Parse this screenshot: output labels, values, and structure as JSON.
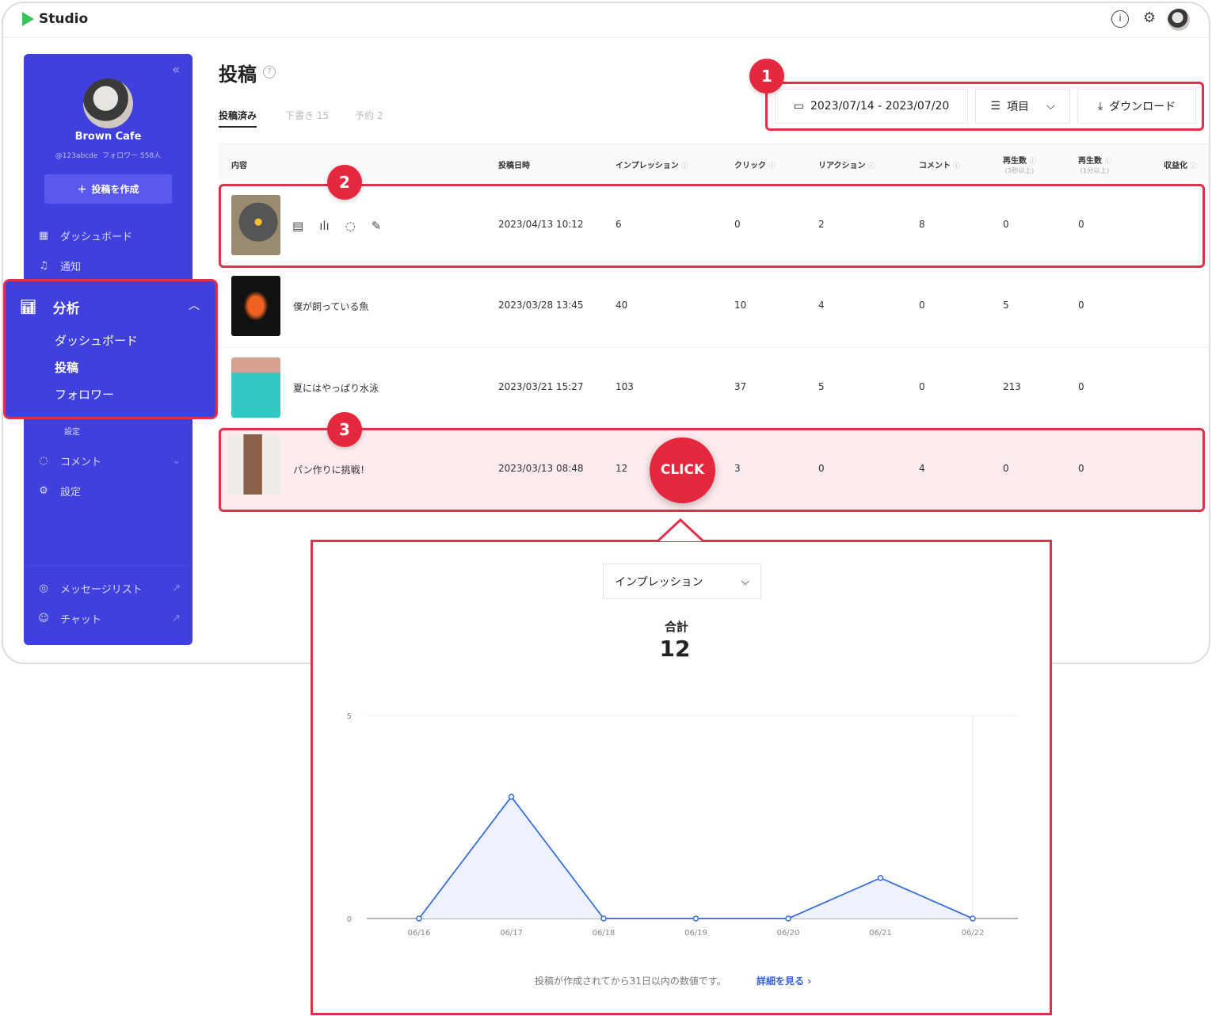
{
  "app": {
    "name": "Studio",
    "icons": [
      "info-icon",
      "gear-icon",
      "avatar"
    ]
  },
  "sidebar": {
    "profile_name": "Brown Cafe",
    "profile_handle": "@123abcde",
    "profile_followers": "フォロワー 558人",
    "create_label": "投稿を作成",
    "collapse_icon": "«",
    "items": [
      {
        "label": "ダッシュボード",
        "icon": "grid-icon"
      },
      {
        "label": "通知",
        "icon": "bell-icon"
      }
    ],
    "analytics": {
      "label": "分析",
      "sub": [
        "ダッシュボード",
        "投稿",
        "フォロワー"
      ],
      "hidden_sub": "設定"
    },
    "items2": [
      {
        "label": "コメント",
        "icon": "comment-icon"
      },
      {
        "label": "設定",
        "icon": "gear-icon"
      }
    ],
    "bottom": [
      {
        "label": "メッセージリスト",
        "icon": "broadcast-icon"
      },
      {
        "label": "チャット",
        "icon": "chat-icon"
      }
    ]
  },
  "page": {
    "title": "投稿",
    "tabs": [
      {
        "label": "投稿済み"
      },
      {
        "label": "下書き 15"
      },
      {
        "label": "予約 2"
      }
    ]
  },
  "toolbar": {
    "date_range": "2023/07/14 - 2023/07/20",
    "columns_label": "項目",
    "download_label": "ダウンロード"
  },
  "badges": [
    "1",
    "2",
    "3"
  ],
  "click_label": "CLICK",
  "table": {
    "headers": [
      "内容",
      "投稿日時",
      "インプレッション",
      "クリック",
      "リアクション",
      "コメント",
      "再生数",
      "再生数",
      "収益化"
    ],
    "subheaders": [
      "(3秒以上)",
      "(1分以上)"
    ],
    "rows": [
      {
        "title": "",
        "date": "2023/04/13 10:12",
        "values": [
          "6",
          "0",
          "2",
          "8",
          "0",
          "0"
        ]
      },
      {
        "title": "僕が飼っている魚",
        "date": "2023/03/28 13:45",
        "values": [
          "40",
          "10",
          "4",
          "0",
          "5",
          "0"
        ]
      },
      {
        "title": "夏にはやっぱり水泳",
        "date": "2023/03/21 15:27",
        "values": [
          "103",
          "37",
          "5",
          "0",
          "213",
          "0"
        ]
      },
      {
        "title": "パン作りに挑戦！",
        "date": "2023/03/13 08:48",
        "values": [
          "12",
          "3",
          "0",
          "4",
          "0",
          "0"
        ]
      }
    ]
  },
  "popup": {
    "metric": "インプレッション",
    "total_label": "合計",
    "total": "12",
    "note": "投稿が作成されてから31日以内の数値です。",
    "detail_link": "詳細を見る"
  },
  "chart_data": {
    "type": "area",
    "x": [
      "06/16",
      "06/17",
      "06/18",
      "06/19",
      "06/20",
      "06/21",
      "06/22"
    ],
    "values": [
      0,
      3,
      0,
      0,
      0,
      1,
      0
    ],
    "yticks": [
      "0",
      "5"
    ],
    "ylim": [
      0,
      5
    ],
    "color": "#3a6ee0"
  }
}
